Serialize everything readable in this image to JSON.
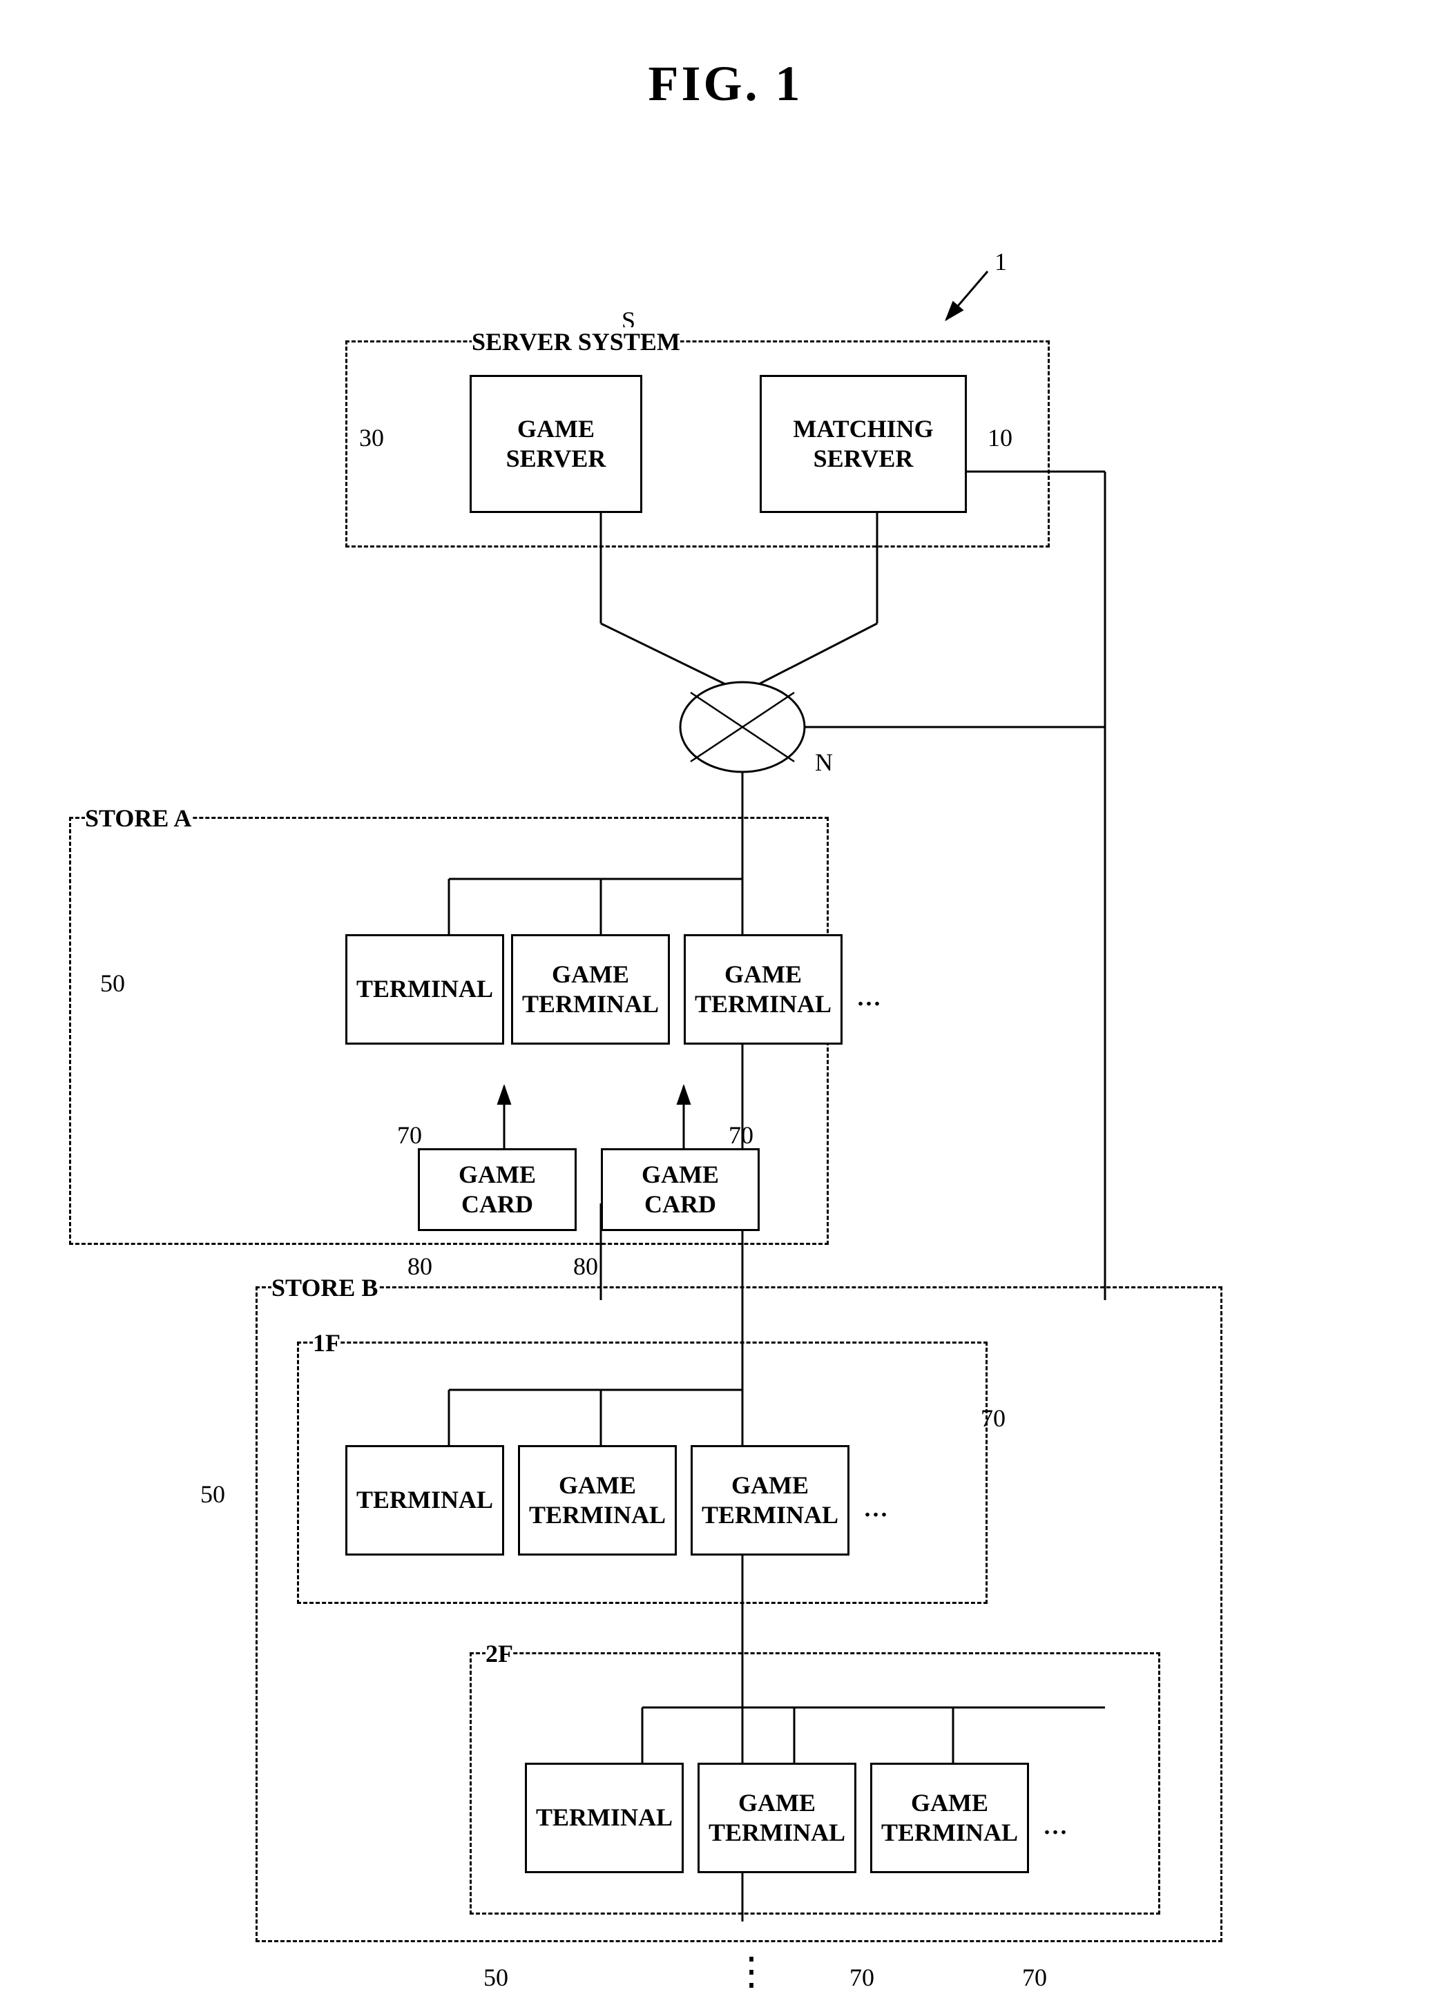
{
  "title": "FIG. 1",
  "labels": {
    "ref1": "1",
    "refS": "S",
    "refN": "N",
    "ref10": "10",
    "ref30": "30",
    "ref50": "50",
    "ref50b1": "50",
    "ref50b2": "50",
    "ref70a1": "70",
    "ref70a2": "70",
    "ref70b1": "70",
    "ref70b2": "70",
    "ref70b3": "70",
    "ref80a1": "80",
    "ref80a2": "80",
    "serverSystem": "SERVER SYSTEM",
    "gameServer": "GAME\nSERVER",
    "matchingServer": "MATCHING\nSERVER",
    "storeA": "STORE A",
    "storeB": "STORE B",
    "floor1F": "1F",
    "floor2F": "2F",
    "terminal1": "TERMINAL",
    "gameTerminal1a": "GAME\nTERMINAL",
    "gameTerminal1b": "GAME\nTERMINAL",
    "gameCard1a": "GAME CARD",
    "gameCard1b": "GAME CARD",
    "terminal2": "TERMINAL",
    "gameTerminal2a": "GAME\nTERMINAL",
    "gameTerminal2b": "GAME\nTERMINAL",
    "terminal3": "TERMINAL",
    "gameTerminal3a": "GAME\nTERMINAL",
    "gameTerminal3b": "GAME\nTERMINAL",
    "ellipsis1": "...",
    "ellipsis2": "...",
    "ellipsis3": "...",
    "ellipsisBottom": "⋮"
  }
}
